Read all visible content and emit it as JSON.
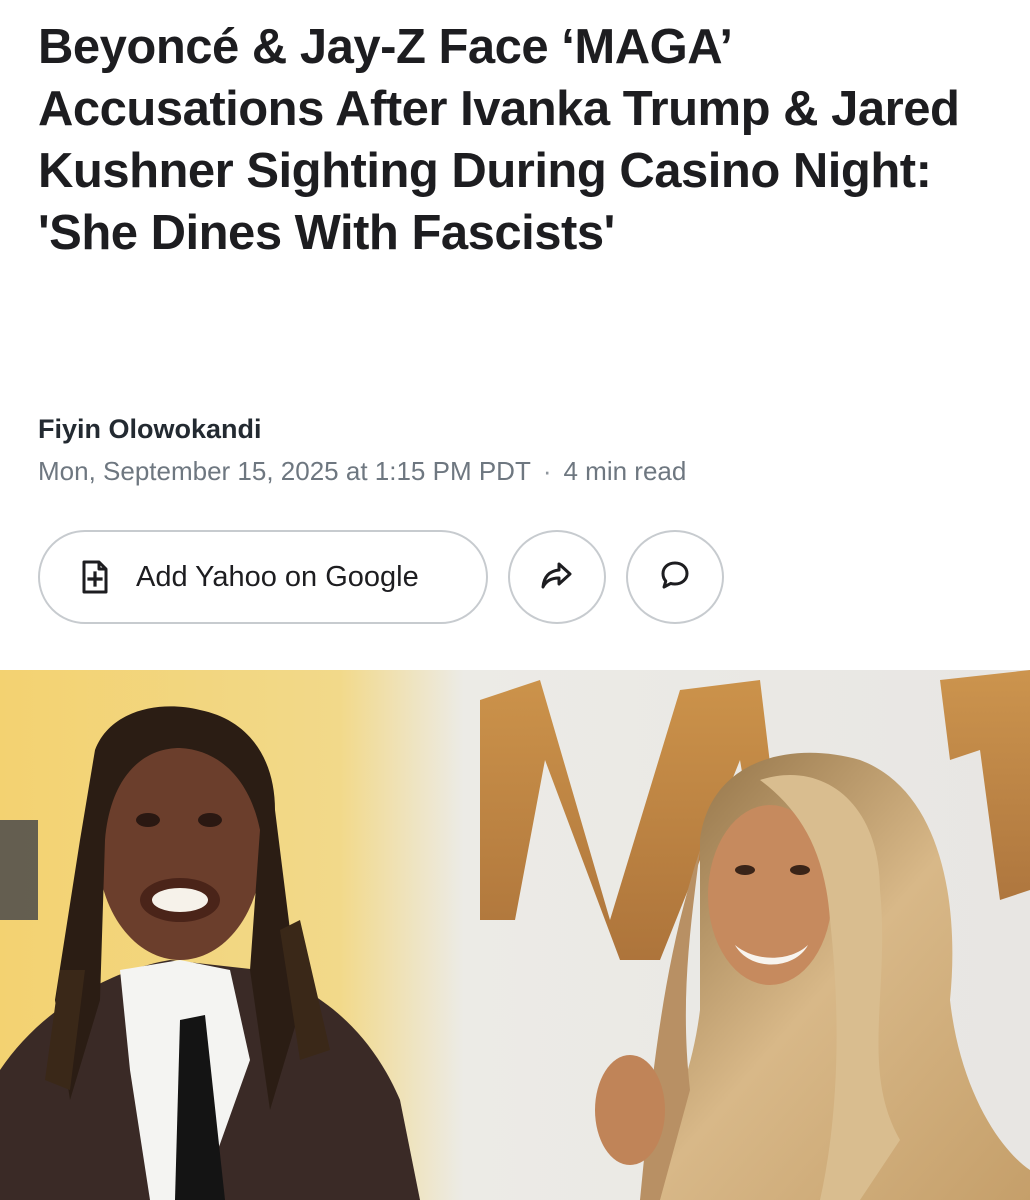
{
  "article": {
    "headline": "Beyoncé & Jay-Z Face ‘MAGA’ Accusations After Ivanka Trump & Jared Kushner Sighting During Casino Night: 'She Dines With Fascists'",
    "author": "Fiyin Olowokandi",
    "date": "Mon, September 15, 2025 at 1:15 PM PDT",
    "separator": "·",
    "read_time": "4 min read"
  },
  "actions": {
    "add_source_label": "Add Yahoo on Google",
    "add_source_icon": "document-plus-icon",
    "share_icon": "share-arrow-icon",
    "comment_icon": "comment-bubble-icon"
  },
  "colors": {
    "text": "#1d1d20",
    "meta": "#6e7780",
    "border": "#c7cbcf"
  }
}
